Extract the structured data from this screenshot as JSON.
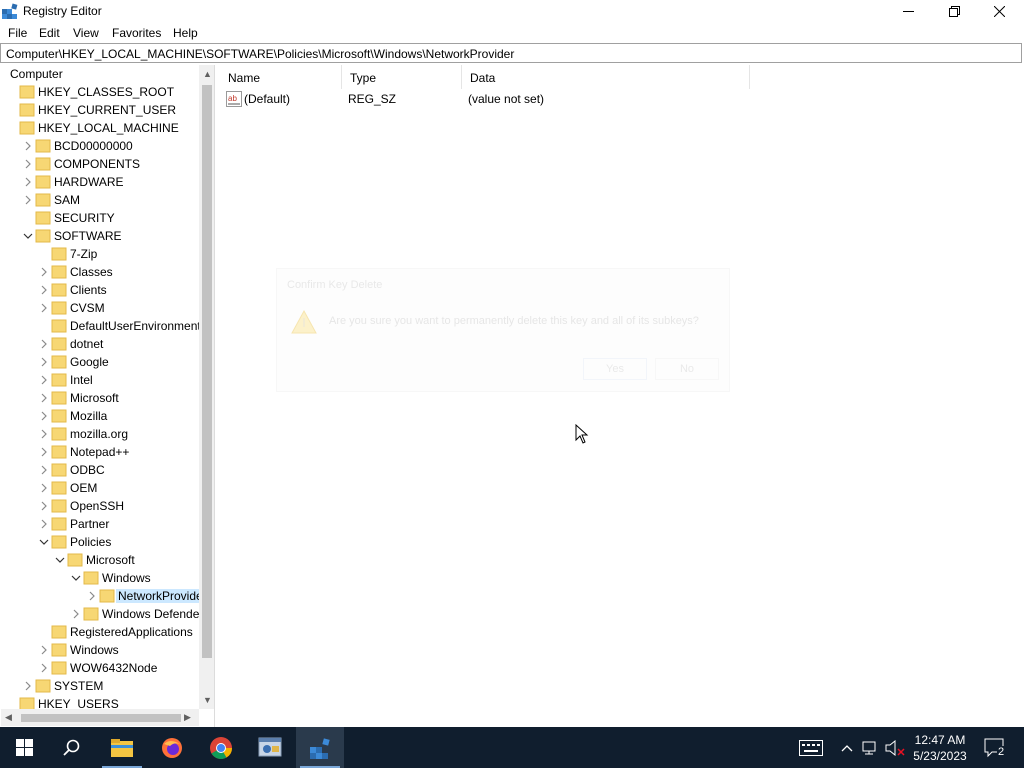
{
  "window": {
    "title": "Registry Editor"
  },
  "menu": [
    "File",
    "Edit",
    "View",
    "Favorites",
    "Help"
  ],
  "address": "Computer\\HKEY_LOCAL_MACHINE\\SOFTWARE\\Policies\\Microsoft\\Windows\\NetworkProvider",
  "tree": [
    {
      "label": "Computer",
      "depth": 0,
      "chevron": "none",
      "folder": false
    },
    {
      "label": "HKEY_CLASSES_ROOT",
      "depth": 1,
      "chevron": "none",
      "folder": true
    },
    {
      "label": "HKEY_CURRENT_USER",
      "depth": 1,
      "chevron": "none",
      "folder": true
    },
    {
      "label": "HKEY_LOCAL_MACHINE",
      "depth": 1,
      "chevron": "none",
      "folder": true
    },
    {
      "label": "BCD00000000",
      "depth": 2,
      "chevron": "right",
      "folder": true
    },
    {
      "label": "COMPONENTS",
      "depth": 2,
      "chevron": "right",
      "folder": true
    },
    {
      "label": "HARDWARE",
      "depth": 2,
      "chevron": "right",
      "folder": true
    },
    {
      "label": "SAM",
      "depth": 2,
      "chevron": "right",
      "folder": true
    },
    {
      "label": "SECURITY",
      "depth": 2,
      "chevron": "none",
      "folder": true
    },
    {
      "label": "SOFTWARE",
      "depth": 2,
      "chevron": "down",
      "folder": true
    },
    {
      "label": "7-Zip",
      "depth": 3,
      "chevron": "none",
      "folder": true
    },
    {
      "label": "Classes",
      "depth": 3,
      "chevron": "right",
      "folder": true
    },
    {
      "label": "Clients",
      "depth": 3,
      "chevron": "right",
      "folder": true
    },
    {
      "label": "CVSM",
      "depth": 3,
      "chevron": "right",
      "folder": true
    },
    {
      "label": "DefaultUserEnvironment",
      "depth": 3,
      "chevron": "none",
      "folder": true
    },
    {
      "label": "dotnet",
      "depth": 3,
      "chevron": "right",
      "folder": true
    },
    {
      "label": "Google",
      "depth": 3,
      "chevron": "right",
      "folder": true
    },
    {
      "label": "Intel",
      "depth": 3,
      "chevron": "right",
      "folder": true
    },
    {
      "label": "Microsoft",
      "depth": 3,
      "chevron": "right",
      "folder": true
    },
    {
      "label": "Mozilla",
      "depth": 3,
      "chevron": "right",
      "folder": true
    },
    {
      "label": "mozilla.org",
      "depth": 3,
      "chevron": "right",
      "folder": true
    },
    {
      "label": "Notepad++",
      "depth": 3,
      "chevron": "right",
      "folder": true
    },
    {
      "label": "ODBC",
      "depth": 3,
      "chevron": "right",
      "folder": true
    },
    {
      "label": "OEM",
      "depth": 3,
      "chevron": "right",
      "folder": true
    },
    {
      "label": "OpenSSH",
      "depth": 3,
      "chevron": "right",
      "folder": true
    },
    {
      "label": "Partner",
      "depth": 3,
      "chevron": "right",
      "folder": true
    },
    {
      "label": "Policies",
      "depth": 3,
      "chevron": "down",
      "folder": true
    },
    {
      "label": "Microsoft",
      "depth": 4,
      "chevron": "down",
      "folder": true
    },
    {
      "label": "Windows",
      "depth": 5,
      "chevron": "down",
      "folder": true
    },
    {
      "label": "NetworkProvider",
      "depth": 6,
      "chevron": "right",
      "folder": true,
      "selected": true
    },
    {
      "label": "Windows Defender",
      "depth": 5,
      "chevron": "right",
      "folder": true
    },
    {
      "label": "RegisteredApplications",
      "depth": 3,
      "chevron": "none",
      "folder": true
    },
    {
      "label": "Windows",
      "depth": 3,
      "chevron": "right",
      "folder": true
    },
    {
      "label": "WOW6432Node",
      "depth": 3,
      "chevron": "right",
      "folder": true
    },
    {
      "label": "SYSTEM",
      "depth": 2,
      "chevron": "right",
      "folder": true
    },
    {
      "label": "HKEY_USERS",
      "depth": 1,
      "chevron": "none",
      "folder": true
    }
  ],
  "list": {
    "columns": [
      "Name",
      "Type",
      "Data"
    ],
    "rows": [
      {
        "name": "(Default)",
        "type": "REG_SZ",
        "data": "(value not set)"
      }
    ]
  },
  "dialog": {
    "title": "Confirm Key Delete",
    "message": "Are you sure you want to permanently delete this key and all of its subkeys?",
    "yes": "Yes",
    "no": "No"
  },
  "taskbar": {
    "time": "12:47 AM",
    "date": "5/23/2023",
    "notification_count": "2"
  },
  "colors": {
    "folder": "#f7d774",
    "selection": "#cce8ff",
    "taskbar": "#101e2e"
  }
}
